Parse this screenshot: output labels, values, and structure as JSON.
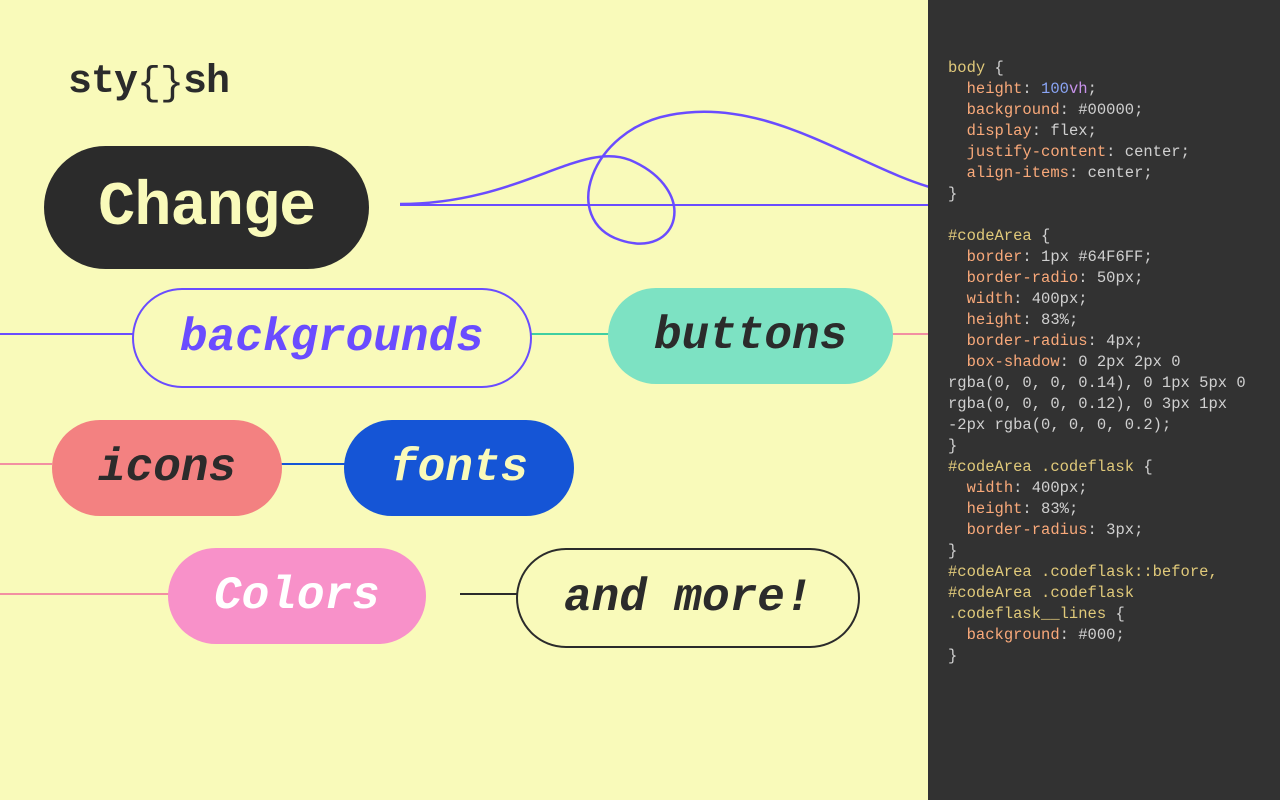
{
  "logo": {
    "pre": "sty",
    "brace": "{}",
    "post": "sh"
  },
  "pills": {
    "change": "Change",
    "backgrounds": "backgrounds",
    "buttons": "buttons",
    "icons": "icons",
    "fonts": "fonts",
    "colors": "Colors",
    "more": "and more!"
  },
  "code": {
    "rules": [
      {
        "selector": "body",
        "declarations": [
          {
            "prop": "height",
            "num": "100",
            "unit": "vh"
          },
          {
            "prop": "background",
            "val": "#00000"
          },
          {
            "prop": "display",
            "val": "flex"
          },
          {
            "prop": "justify-content",
            "val": "center"
          },
          {
            "prop": "align-items",
            "val": "center"
          }
        ]
      },
      {
        "selector": "#codeArea",
        "blank_before": true,
        "declarations": [
          {
            "prop": "border",
            "val": "1px #64F6FF"
          },
          {
            "prop": "border-radio",
            "val": "50px"
          },
          {
            "prop": "width",
            "val": "400px"
          },
          {
            "prop": "height",
            "val": "83%"
          },
          {
            "prop": "border-radius",
            "val": "4px"
          },
          {
            "prop": "box-shadow",
            "val": "0 2px 2px 0 rgba(0, 0, 0, 0.14), 0 1px 5px 0 rgba(0, 0, 0, 0.12), 0 3px 1px -2px rgba(0, 0, 0, 0.2)",
            "multiline": true
          }
        ]
      },
      {
        "selector": "#codeArea .codeflask",
        "declarations": [
          {
            "prop": "width",
            "val": "400px"
          },
          {
            "prop": "height",
            "val": "83%"
          },
          {
            "prop": "border-radius",
            "val": "3px"
          }
        ]
      },
      {
        "selector": "#codeArea .codeflask::before,\n#codeArea .codeflask .codeflask__lines",
        "multiline_selector": [
          "#codeArea .codeflask::before,",
          "#codeArea .codeflask",
          ".codeflask__lines"
        ],
        "declarations": [
          {
            "prop": "background",
            "val": "#000"
          }
        ]
      }
    ]
  }
}
